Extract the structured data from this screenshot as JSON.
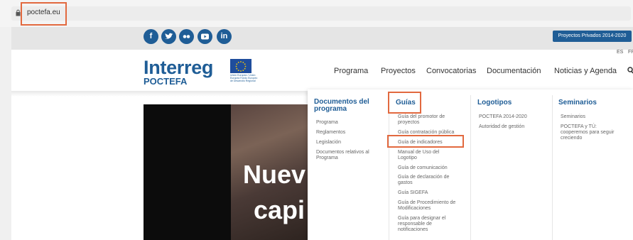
{
  "browser": {
    "url": "poctefa.eu"
  },
  "topbar": {
    "social": [
      "f",
      "t",
      "fl",
      "yt",
      "in"
    ],
    "private_projects_button": "Proyectos Privados 2014-2020",
    "languages": [
      "ES",
      "FR"
    ]
  },
  "header": {
    "logo_main": "Interreg",
    "logo_sub": "POCTEFA",
    "eu_text": "Unión Europea / Unión Europea Fondo Europeo de Desarrollo Regional",
    "nav": [
      "Programa",
      "Proyectos",
      "Convocatorias",
      "Documentación",
      "Noticias y Agenda"
    ]
  },
  "hero": {
    "line1": "Nuev",
    "line2": "capi"
  },
  "menu": {
    "col1": {
      "title_line1": "Documentos del",
      "title_line2": "programa",
      "items": [
        "Programa",
        "Reglamentos",
        "Legislación",
        "Documentos relativos al",
        "Programa"
      ]
    },
    "col2": {
      "title": "Guías",
      "items": [
        "Guía del promotor de",
        "proyectos",
        "Guía contratación pública",
        "Guía de indicadores",
        "Manual de Uso del",
        "Logotipo",
        "Guía de comunicación",
        "Guía de declaración de",
        "gastos",
        "Guía SIGEFA",
        "Guía de Procedimiento de",
        "Modificaciones",
        "Guía para designar el",
        "responsable de",
        "notificaciones"
      ]
    },
    "col3": {
      "title": "Logotipos",
      "items": [
        "POCTEFA 2014-2020",
        "Autoridad de gestión"
      ]
    },
    "col4": {
      "title": "Seminarios",
      "items": [
        "Seminarios",
        "POCTEFA y TÚ:",
        "cooperemos para seguir",
        "creciendo"
      ]
    }
  },
  "colors": {
    "brand_blue": "#1f5d96",
    "highlight": "#e2693f"
  }
}
